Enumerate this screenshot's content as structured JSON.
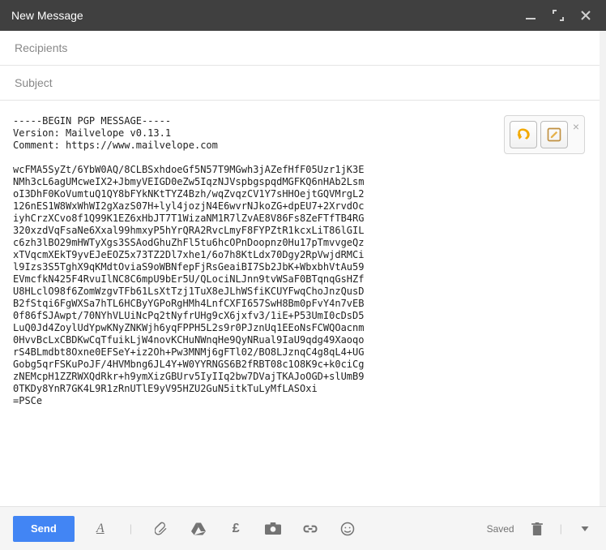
{
  "titlebar": {
    "title": "New Message",
    "icons": {
      "minimize_name": "minimize-icon",
      "fullscreen_name": "fullscreen-icon",
      "close_name": "close-icon"
    }
  },
  "recipients": {
    "placeholder": "Recipients",
    "value": ""
  },
  "subject": {
    "placeholder": "Subject",
    "value": ""
  },
  "mailvelope_panel": {
    "undo_name": "undo-icon",
    "compose_name": "compose-icon",
    "close_name": "close-icon"
  },
  "body_lines": [
    "-----BEGIN PGP MESSAGE-----",
    "Version: Mailvelope v0.13.1",
    "Comment: https://www.mailvelope.com",
    "",
    "wcFMA5SyZt/6YbW0AQ/8CLBSxhdoeGf5N57T9MGwh3jAZefHfF05Uzr1jK3E",
    "NMh3cL6agUMcweIX2+JbmyVEIGD0eZw5IqzNJVspbgspqdMGFKQ6nHAb2Lsm",
    "oI3DhF0KoVumtuQ1QY8bFYkNKtTYZ4Bzh/wqZvqzCV1Y7sHHOejtGQVMrgL2",
    "126nES1W8WxWhWI2gXazS07H+lyl4jozjN4E6wvrNJkoZG+dpEU7+2XrvdOc",
    "iyhCrzXCvo8f1Q99K1EZ6xHbJT7T1WizaNM1R7lZvAE8V86Fs8ZeFTfTB4RG",
    "320xzdVqFsaNe6Xxal99hmxyP5hYrQRA2RvcLmyF8FYPZtR1kcxLiT86lGIL",
    "c6zh3lBO29mHWTyXgs3SSAodGhuZhFl5tu6hcOPnDoopnz0Hu17pTmvvgeQz",
    "xTVqcmXEkT9yvEJeEOZ5x73TZ2Dl7xhe1/6o7h8KtLdx70Dgy2RpVwjdRMCi",
    "l9Izs3S5TghX9qKMdtOviaS9oWBNfepFjRsGeaiBI7Sb2JbK+WbxbhVtAu59",
    "EVmcfkN425F4RvuIlNC8C6mpU9bEr5U/QLociNLJnn9tvWSaF0BTqnqGsHZf",
    "U8HLclO98f6ZomWzgvTFb61LsXtTzj1TuX8eJLhWSfiKCUYFwqChoJnzQusD",
    "B2fStqi6FgWXSa7hTL6HCByYGPoRgHMh4LnfCXFI657SwH8Bm0pFvY4n7vEB",
    "0f86fSJAwpt/70NYhVLUiNcPq2tNyfrUHg9cX6jxfv3/1iE+P53UmI0cDsD5",
    "LuQ0Jd4ZoylUdYpwKNyZNKWjh6yqFPPH5L2s9r0PJznUq1EEoNsFCWQOacnm",
    "0HvvBcLxCBDKwCqTfuikLjW4novKCHuNWnqHe9QyNRual9IaU9qdg49Xaoqo",
    "rS4BLmdbt8Oxne0EFSeY+iz2Oh+Pw3MNMj6gFTl02/BO8LJznqC4g8qL4+UG",
    "Gobg5qrFSKuPoJF/4HVMbng6JL4Y+W0YYRNGS6B2fRBT08c1O8K9c+k0ciCg",
    "zNEMcpH1ZZRWXQdRkr+h9ymXizGBUrv5IyIIq2bw7DVajTKAJoOGD+slUmB9",
    "0TKDy8YnR7GK4L9R1zRnUTlE9yV95HZU2GuN5itkTuLyMfLASOxi",
    "=PSCe"
  ],
  "footer": {
    "send_label": "Send",
    "saved_label": "Saved",
    "icons": {
      "format": "format-icon",
      "attach": "attach-icon",
      "drive": "drive-icon",
      "money": "insert-money-icon",
      "photo": "insert-photo-icon",
      "link": "insert-link-icon",
      "emoji": "insert-emoji-icon",
      "trash": "trash-icon",
      "more": "more-icon"
    }
  }
}
